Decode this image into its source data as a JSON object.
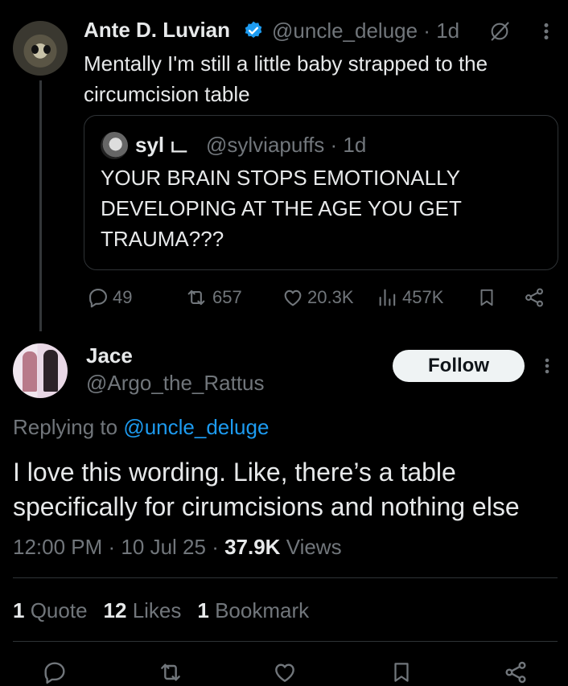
{
  "parent": {
    "name": "Ante D. Luvian",
    "handle_time": "@uncle_deluge · 1d",
    "text": "Mentally I'm still a little baby strapped to the circumcision table",
    "quote": {
      "name": "syl ட",
      "handle_time": "@sylviapuffs · 1d",
      "text": "YOUR BRAIN STOPS EMOTIONALLY DEVELOPING AT THE AGE YOU GET TRAUMA???"
    },
    "actions": {
      "replies": "49",
      "reposts": "657",
      "likes": "20.3K",
      "views": "457K"
    }
  },
  "reply": {
    "name": "Jace",
    "handle": "@Argo_the_Rattus",
    "follow_label": "Follow",
    "replying_prefix": "Replying to ",
    "replying_handle": "@uncle_deluge",
    "text": "I love this wording. Like, there’s a table specifically for cirumcisions and nothing else",
    "time": "12:00 PM",
    "date": "10 Jul 25",
    "views_count": "37.9K",
    "views_label": "Views",
    "stats": {
      "quotes_count": "1",
      "quotes_label": "Quote",
      "likes_count": "12",
      "likes_label": "Likes",
      "bookmarks_count": "1",
      "bookmarks_label": "Bookmark"
    }
  },
  "colors": {
    "background": "#000000",
    "text": "#e7e9ea",
    "secondary": "#71767b",
    "link": "#1d9bf0",
    "verified": "#1d9bf0"
  },
  "icons": [
    "reply-icon",
    "repost-icon",
    "like-icon",
    "views-icon",
    "bookmark-icon",
    "share-icon",
    "verified-icon",
    "mute-icon",
    "more-icon"
  ]
}
